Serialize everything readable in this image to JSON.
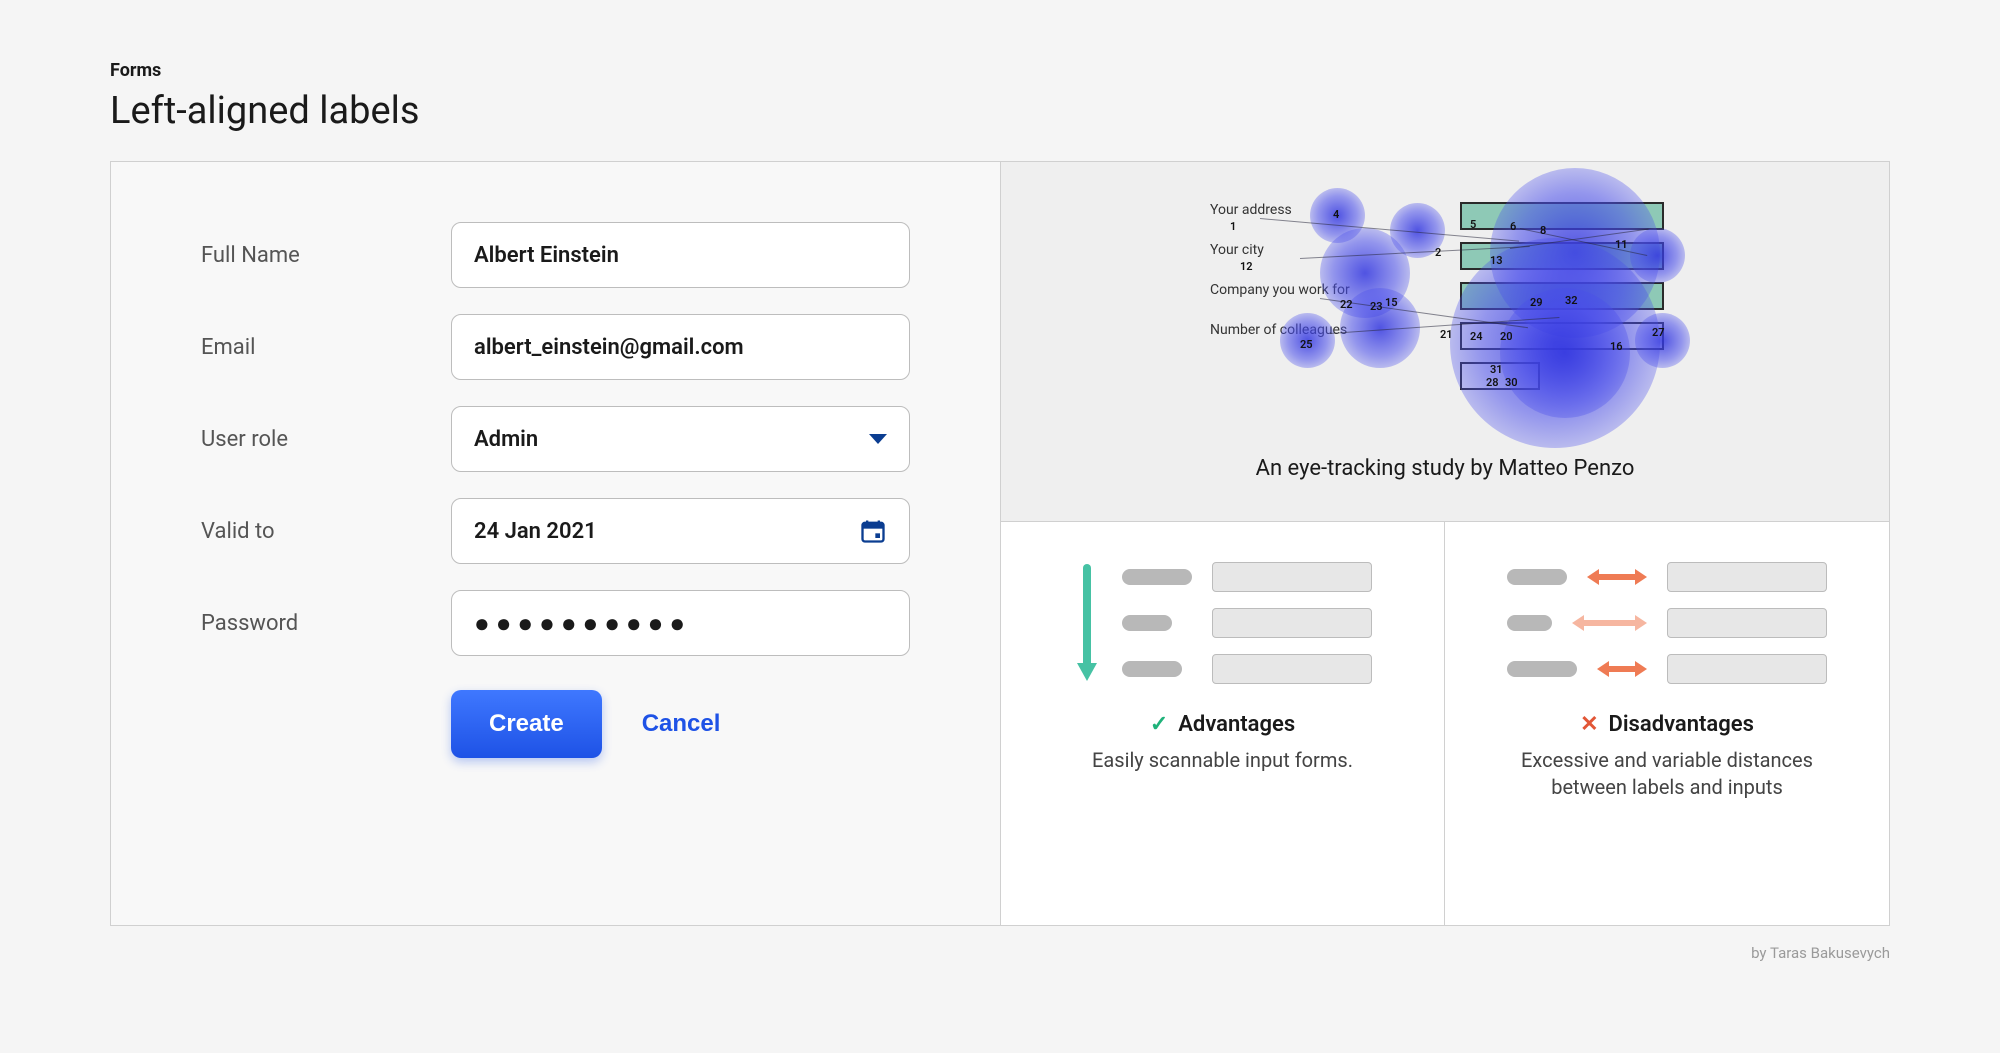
{
  "header": {
    "eyebrow": "Forms",
    "title": "Left-aligned labels"
  },
  "form": {
    "fields": {
      "full_name": {
        "label": "Full Name",
        "value": "Albert Einstein"
      },
      "email": {
        "label": "Email",
        "value": "albert_einstein@gmail.com"
      },
      "user_role": {
        "label": "User role",
        "value": "Admin"
      },
      "valid_to": {
        "label": "Valid to",
        "value": "24 Jan 2021"
      },
      "password": {
        "label": "Password",
        "value": "●●●●●●●●●●"
      }
    },
    "buttons": {
      "primary": "Create",
      "secondary": "Cancel"
    }
  },
  "study": {
    "caption": "An eye-tracking study by Matteo Penzo",
    "labels": [
      "Your address",
      "Your city",
      "Company you work for",
      "Number of colleagues"
    ]
  },
  "advantages": {
    "title": "Advantages",
    "body": "Easily scannable input forms."
  },
  "disadvantages": {
    "title": "Disadvantages",
    "body": "Excessive and variable distances between labels and inputs"
  },
  "credit": "by Taras Bakusevych"
}
